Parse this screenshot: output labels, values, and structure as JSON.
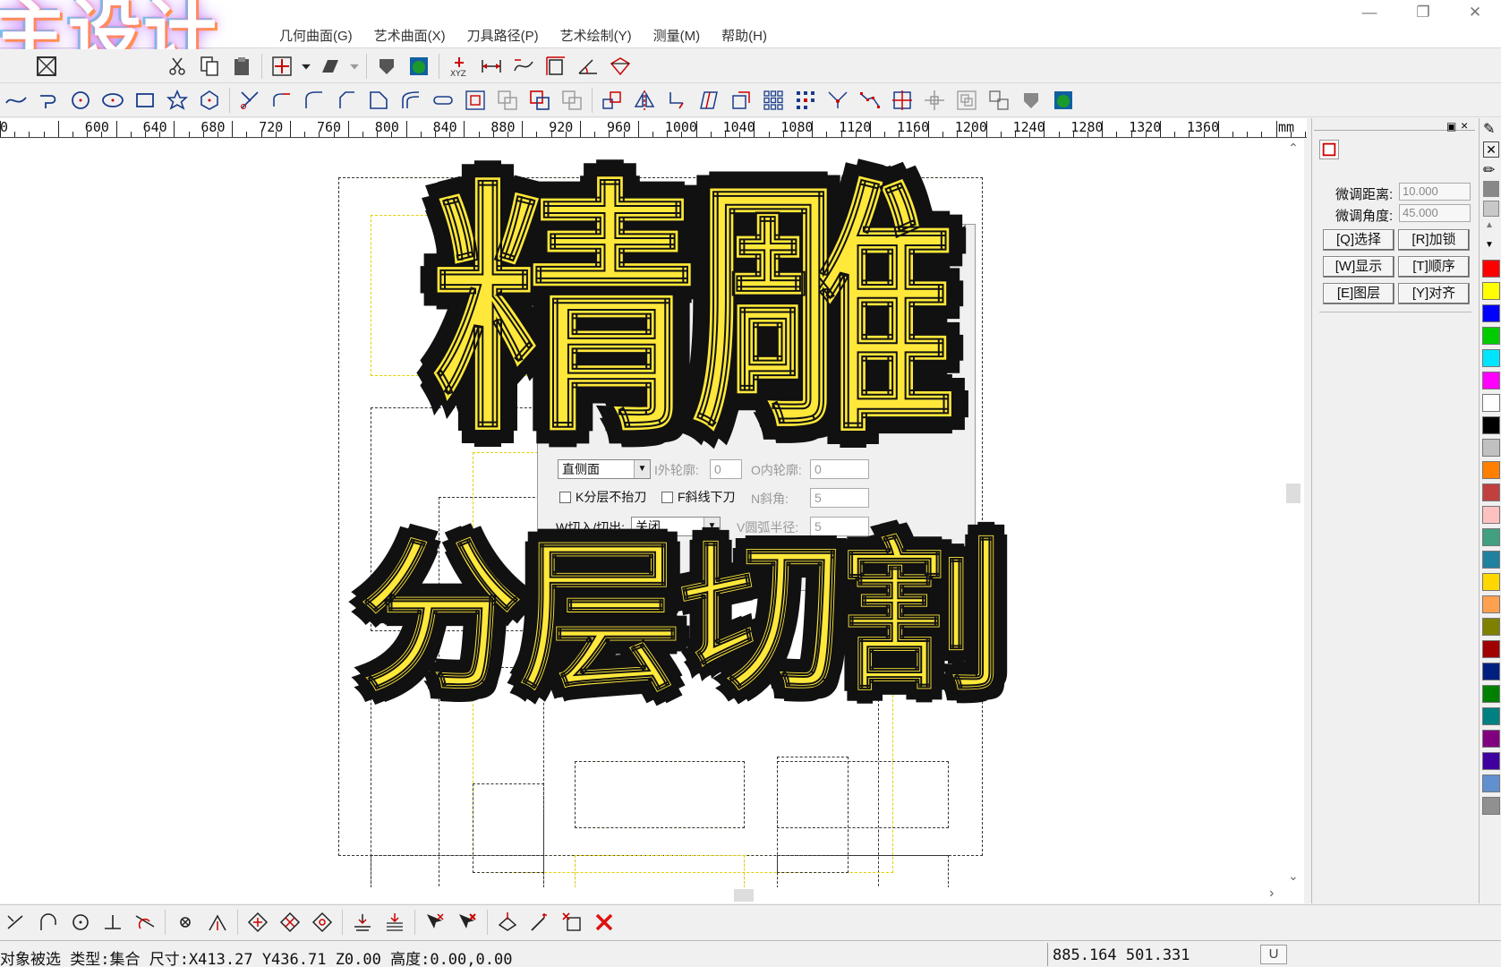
{
  "menu": [
    "几何曲面(G)",
    "艺术曲面(X)",
    "刀具路径(P)",
    "艺术绘制(Y)",
    "测量(M)",
    "帮助(H)"
  ],
  "logo_overlay": "主设计",
  "ruler": {
    "labels": [
      "0",
      "600",
      "640",
      "680",
      "720",
      "760",
      "800",
      "840",
      "880",
      "920",
      "960",
      "1000",
      "1040",
      "1080",
      "1120",
      "1160",
      "1200",
      "1240",
      "1280",
      "1320",
      "1360"
    ],
    "unit": "mm"
  },
  "dialog": {
    "surface_combo": "直侧面",
    "outer_label": "I外轮廓:",
    "outer_value": "0",
    "inner_label": "O内轮廓:",
    "inner_value": "0",
    "layer_check": "K分层不抬刀",
    "slant_check": "F斜线下刀",
    "slant_angle_label": "N斜角:",
    "slant_angle_value": "5",
    "inout_label": "W切入/切出:",
    "inout_combo": "关闭",
    "arc_label": "V圆弧半径:",
    "arc_value": "5"
  },
  "overlay": {
    "line1": "精雕",
    "line2": "分层切割"
  },
  "right_panel": {
    "fine_dist_label": "微调距离:",
    "fine_dist_value": "10.000",
    "fine_angle_label": "微调角度:",
    "fine_angle_value": "45.000",
    "buttons": [
      "[Q]选择",
      "[R]加锁",
      "[W]显示",
      "[T]顺序",
      "[E]图层",
      "[Y]对齐"
    ]
  },
  "palette_colors": [
    "#ff0000",
    "#ffff00",
    "#0000ff",
    "#00cc00",
    "#00e5ff",
    "#ff00ff",
    "#ffffff",
    "#000000",
    "#c0c0c0",
    "#ff8000",
    "#c04040",
    "#ffc0c0",
    "#40a080",
    "#2080a0",
    "#ffd700",
    "#ffa050",
    "#808000",
    "#a00000",
    "#002080",
    "#008000",
    "#008080",
    "#800080",
    "#4000a0",
    "#6090d0",
    "#909090"
  ],
  "status": {
    "message": "对象被选 类型:集合 尺寸:X413.27 Y436.71 Z0.00 高度:0.00,0.00",
    "coords": "885.164 501.331",
    "unit_box": "U"
  }
}
